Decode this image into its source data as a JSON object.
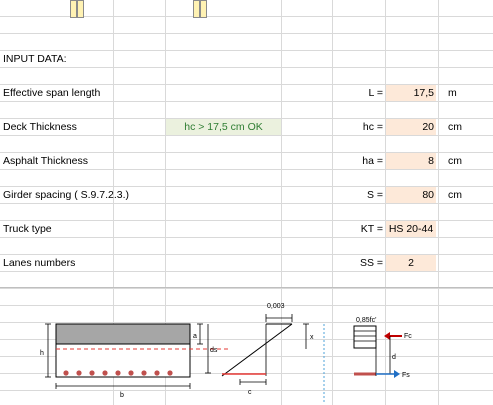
{
  "sheet": {
    "section_title": "INPUT DATA:",
    "rows": [
      {
        "label": "Effective span length",
        "symbol": "L =",
        "value": "17,5",
        "unit": "m"
      },
      {
        "label": "Deck Thickness",
        "check": "hc  >  17,5 cm   OK",
        "symbol": "hc =",
        "value": "20",
        "unit": "cm"
      },
      {
        "label": "Asphalt Thickness",
        "symbol": "ha =",
        "value": "8",
        "unit": "cm"
      },
      {
        "label": "Girder spacing ( S.9.7.2.3.)",
        "symbol": "S =",
        "value": "80",
        "unit": "cm"
      },
      {
        "label": "Truck type",
        "symbol": "KT =",
        "value": "HS 20-44",
        "unit": ""
      },
      {
        "label": "Lanes numbers",
        "symbol": "SS =",
        "value": "2",
        "unit": ""
      }
    ]
  },
  "diagram": {
    "labels": {
      "h": "h",
      "b": "b",
      "a": "a",
      "ds": "ds",
      "c": "c",
      "x": "x",
      "d": "d",
      "strain": "0,003",
      "stress": "0,85fc'",
      "Fc": "Fc",
      "Fs": "Fs"
    }
  }
}
